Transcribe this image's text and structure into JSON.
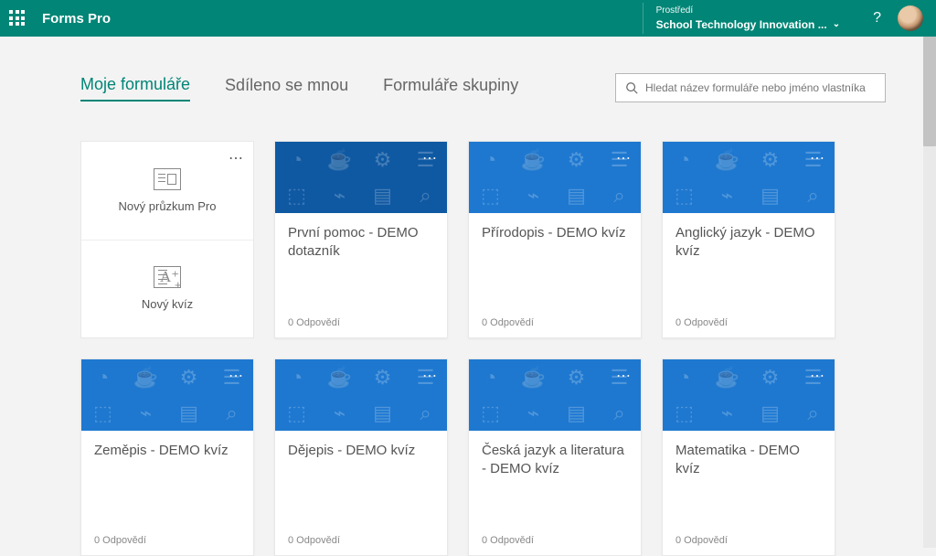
{
  "header": {
    "app_title": "Forms Pro",
    "env_label": "Prostředí",
    "env_name": "School Technology Innovation ...",
    "help": "?"
  },
  "tabs": {
    "my_forms": "Moje formuláře",
    "shared": "Sdíleno se mnou",
    "group": "Formuláře skupiny"
  },
  "search": {
    "placeholder": "Hledat název formuláře nebo jméno vlastníka"
  },
  "new_card": {
    "survey": "Nový průzkum Pro",
    "quiz": "Nový kvíz"
  },
  "cards": [
    {
      "title": "První pomoc - DEMO dotazník",
      "responses": "0 Odpovědí",
      "variant": "dark"
    },
    {
      "title": "Přírodopis - DEMO kvíz",
      "responses": "0 Odpovědí",
      "variant": "light"
    },
    {
      "title": "Anglický jazyk - DEMO kvíz",
      "responses": "0 Odpovědí",
      "variant": "light"
    },
    {
      "title": "Zeměpis - DEMO kvíz",
      "responses": "0 Odpovědí",
      "variant": "light"
    },
    {
      "title": "Dějepis - DEMO kvíz",
      "responses": "0 Odpovědí",
      "variant": "light"
    },
    {
      "title": "Česká jazyk a literatura - DEMO kvíz",
      "responses": "0 Odpovědí",
      "variant": "light"
    },
    {
      "title": "Matematika - DEMO kvíz",
      "responses": "0 Odpovědí",
      "variant": "light"
    }
  ]
}
